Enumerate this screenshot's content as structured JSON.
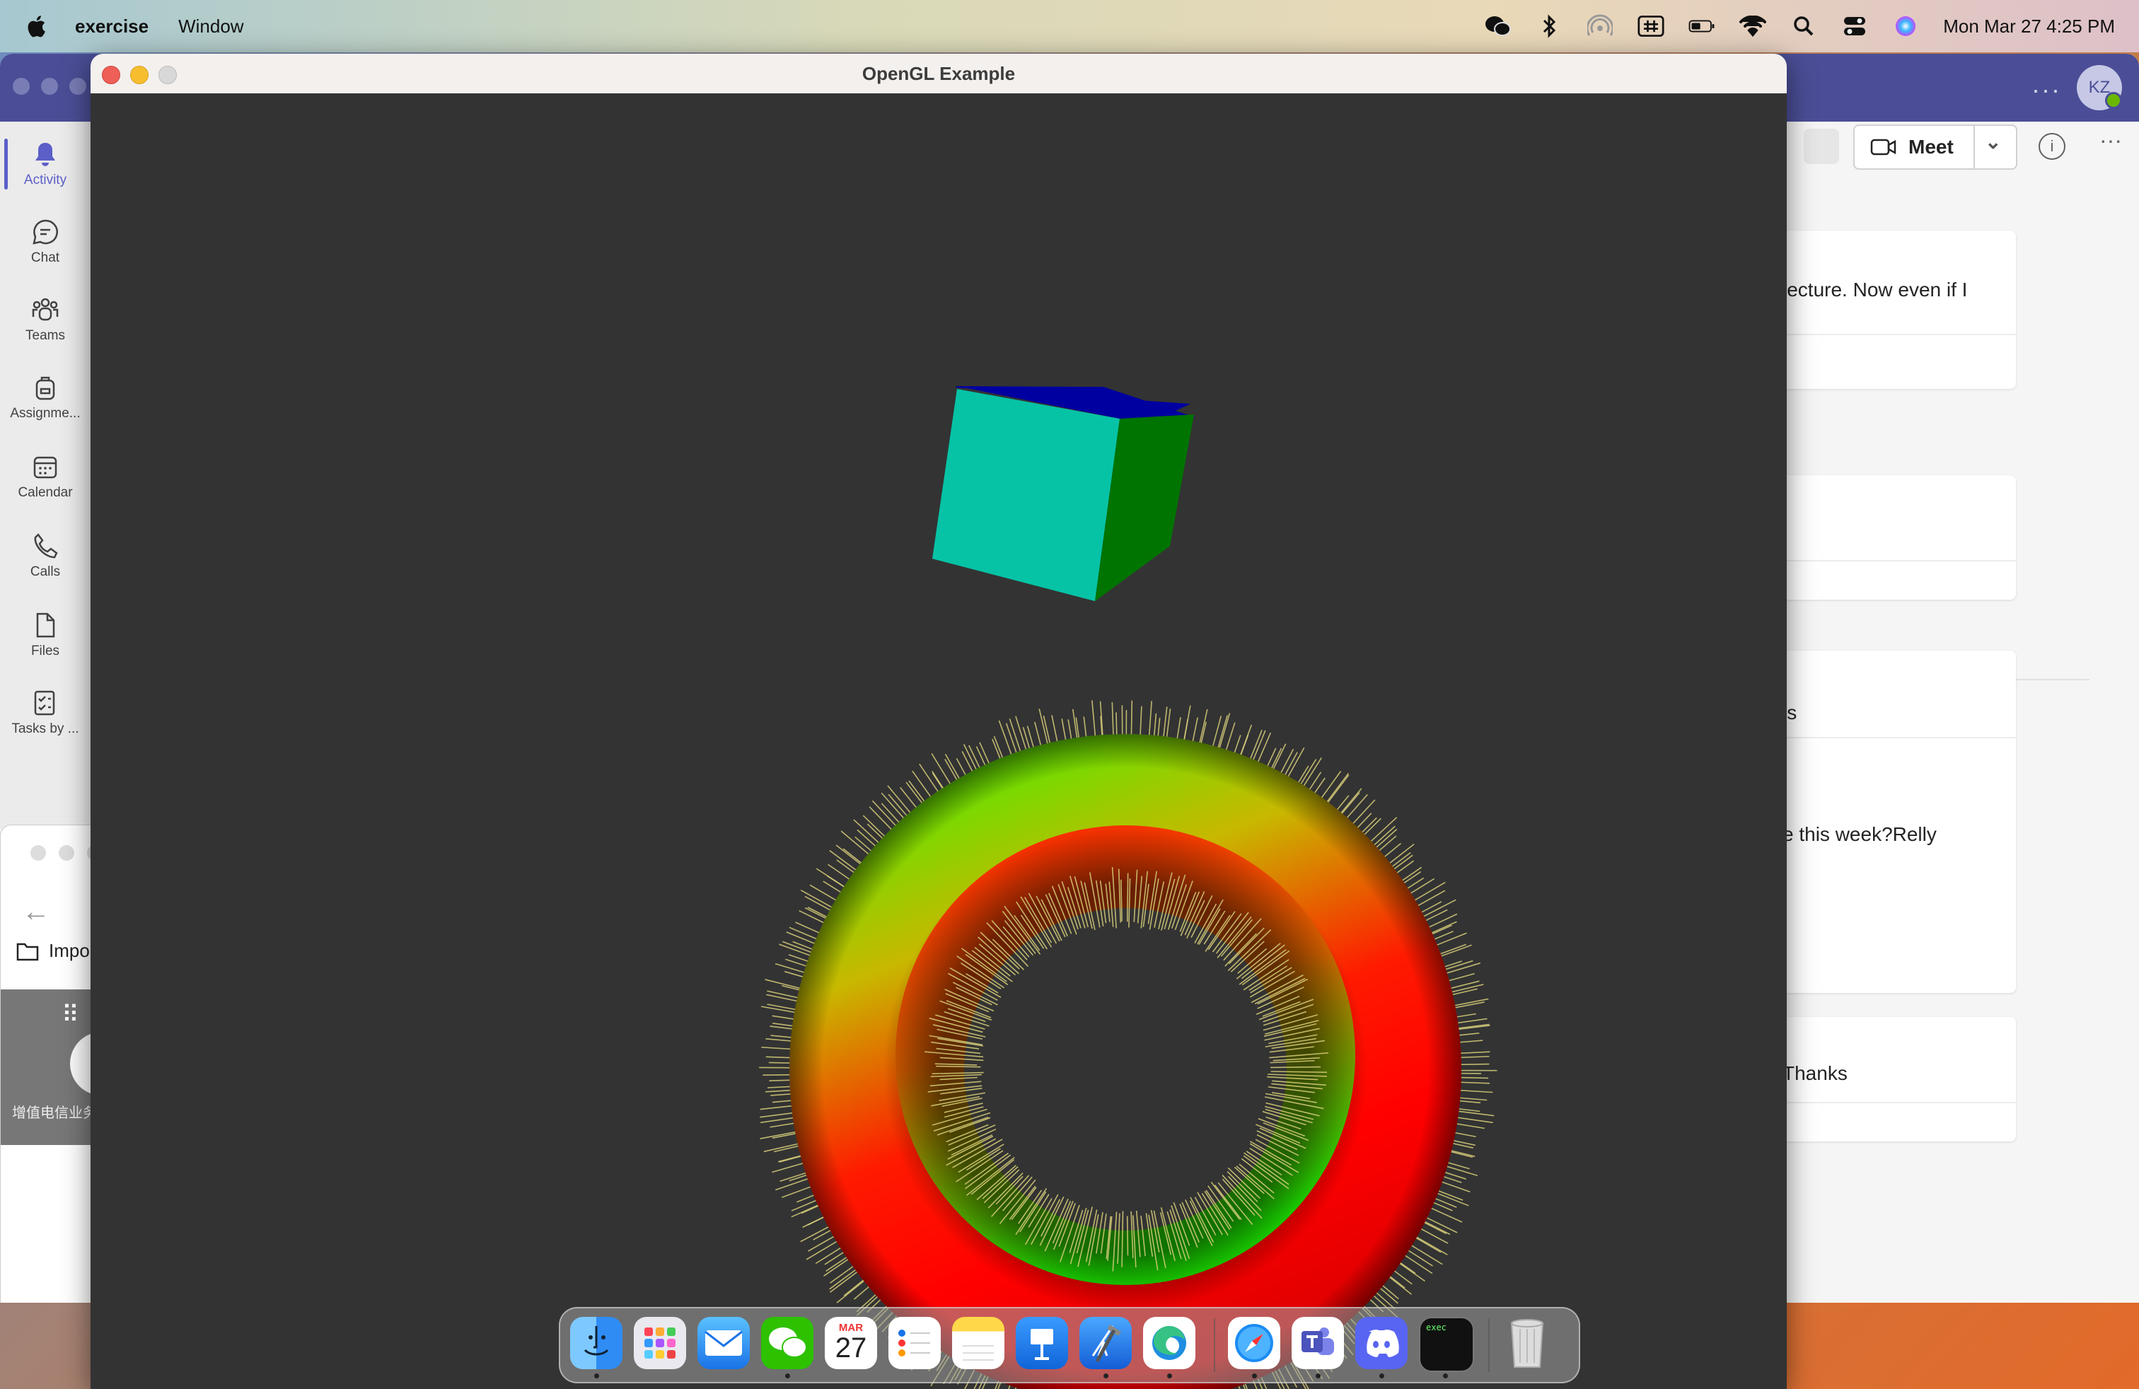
{
  "menubar": {
    "app_name": "exercise",
    "menu_items": [
      "Window"
    ],
    "clock": "Mon Mar 27  4:25 PM",
    "icons": [
      "wechat-icon",
      "bluetooth-icon",
      "airdrop-icon",
      "input-method-icon",
      "battery-icon",
      "wifi-icon",
      "search-icon",
      "control-center-icon",
      "siri-icon"
    ]
  },
  "teams": {
    "avatar_initials": "KZ",
    "rail": [
      {
        "label": "Activity",
        "icon": "bell-icon",
        "active": true
      },
      {
        "label": "Chat",
        "icon": "chat-icon"
      },
      {
        "label": "Teams",
        "icon": "teams-icon"
      },
      {
        "label": "Assignme...",
        "icon": "backpack-icon"
      },
      {
        "label": "Calendar",
        "icon": "calendar-icon"
      },
      {
        "label": "Calls",
        "icon": "phone-icon"
      },
      {
        "label": "Files",
        "icon": "file-icon"
      },
      {
        "label": "Tasks by ...",
        "icon": "tasks-icon"
      }
    ],
    "meet_label": "Meet",
    "messages": [
      "lecture. Now even if I",
      "ls",
      "e this week?Relly",
      "Thanks"
    ],
    "mini_window": {
      "import_label": "Impo",
      "chinese_label": "增值电信业务"
    }
  },
  "gl_window": {
    "title": "OpenGL Example",
    "background": "#333333",
    "cube_colors": {
      "front": "#06c3a6",
      "right": "#007400",
      "top": "#0000a0"
    }
  },
  "dock": {
    "apps": [
      {
        "name": "Finder",
        "icon": "finder-icon",
        "running": true
      },
      {
        "name": "Launchpad",
        "icon": "launchpad-icon",
        "running": false
      },
      {
        "name": "Mail",
        "icon": "mail-icon",
        "running": false
      },
      {
        "name": "WeChat",
        "icon": "wechat-icon",
        "running": true
      },
      {
        "name": "Calendar",
        "icon": "calendar-icon",
        "running": false,
        "month": "MAR",
        "day": "27"
      },
      {
        "name": "Reminders",
        "icon": "reminders-icon",
        "running": false
      },
      {
        "name": "Notes",
        "icon": "notes-icon",
        "running": false
      },
      {
        "name": "Keynote",
        "icon": "keynote-icon",
        "running": false
      },
      {
        "name": "Xcode",
        "icon": "xcode-icon",
        "running": true
      },
      {
        "name": "Edge",
        "icon": "edge-icon",
        "running": true
      },
      {
        "name": "Safari",
        "icon": "safari-icon",
        "running": true
      },
      {
        "name": "Teams",
        "icon": "teams-icon",
        "running": true
      },
      {
        "name": "Discord",
        "icon": "discord-icon",
        "running": true
      },
      {
        "name": "Terminal",
        "icon": "terminal-icon",
        "running": true,
        "label": "exec"
      },
      {
        "name": "Trash",
        "icon": "trash-icon",
        "running": false
      }
    ]
  }
}
